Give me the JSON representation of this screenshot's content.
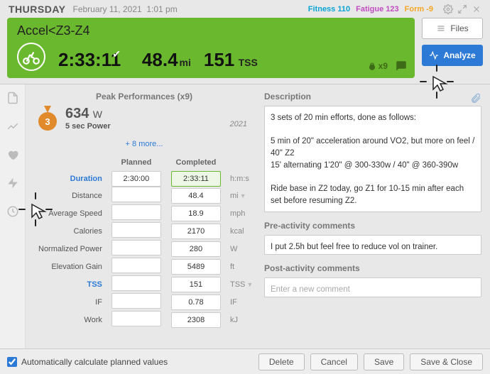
{
  "header": {
    "day": "THURSDAY",
    "date": "February 11, 2021",
    "time": "1:01 pm",
    "fitness_label": "Fitness",
    "fitness_value": "110",
    "fatigue_label": "Fatigue",
    "fatigue_value": "123",
    "form_label": "Form",
    "form_value": "-9"
  },
  "activity": {
    "title": "Accel<Z3-Z4",
    "duration": "2:33:11",
    "distance": "48.4",
    "distance_unit": "mi",
    "tss": "151",
    "tss_unit": "TSS",
    "peak_badge": "x9"
  },
  "side_buttons": {
    "files": "Files",
    "analyze": "Analyze"
  },
  "peak": {
    "section_title": "Peak Performances (x9)",
    "rank": "3",
    "value": "634",
    "unit": "W",
    "label": "5 sec Power",
    "year": "2021",
    "more": "+ 8 more..."
  },
  "stats": {
    "col_planned": "Planned",
    "col_completed": "Completed",
    "rows": [
      {
        "label": "Duration",
        "link": true,
        "planned": "2:30:00",
        "completed": "2:33:11",
        "completed_hl": true,
        "unit": "h:m:s",
        "chev": false
      },
      {
        "label": "Distance",
        "link": false,
        "planned": "",
        "completed": "48.4",
        "completed_hl": false,
        "unit": "mi",
        "chev": true
      },
      {
        "label": "Average Speed",
        "link": false,
        "planned": "",
        "completed": "18.9",
        "completed_hl": false,
        "unit": "mph",
        "chev": false
      },
      {
        "label": "Calories",
        "link": false,
        "planned": "",
        "completed": "2170",
        "completed_hl": false,
        "unit": "kcal",
        "chev": false
      },
      {
        "label": "Normalized Power",
        "link": false,
        "planned": "",
        "completed": "280",
        "completed_hl": false,
        "unit": "W",
        "chev": false
      },
      {
        "label": "Elevation Gain",
        "link": false,
        "planned": "",
        "completed": "5489",
        "completed_hl": false,
        "unit": "ft",
        "chev": false
      },
      {
        "label": "TSS",
        "link": true,
        "planned": "",
        "completed": "151",
        "completed_hl": false,
        "unit": "TSS",
        "chev": true
      },
      {
        "label": "IF",
        "link": false,
        "planned": "",
        "completed": "0.78",
        "completed_hl": false,
        "unit": "IF",
        "chev": false
      },
      {
        "label": "Work",
        "link": false,
        "planned": "",
        "completed": "2308",
        "completed_hl": false,
        "unit": "kJ",
        "chev": false
      }
    ]
  },
  "description": {
    "title": "Description",
    "text": "3 sets of 20 min efforts, done as follows:\n\n5 min of 20\" acceleration around VO2, but more on feel / 40\" Z2\n15' alternating 1'20\" @ 300-330w / 40\" @ 360-390w\n\nRide base in Z2 today, go Z1 for 10-15 min after each set before resuming Z2."
  },
  "pre_comments": {
    "title": "Pre-activity comments",
    "text": "I put 2.5h but feel free to reduce vol on trainer."
  },
  "post_comments": {
    "title": "Post-activity comments",
    "placeholder": "Enter a new comment"
  },
  "footer": {
    "auto_calc": "Automatically calculate planned values",
    "delete": "Delete",
    "cancel": "Cancel",
    "save": "Save",
    "save_close": "Save & Close"
  }
}
